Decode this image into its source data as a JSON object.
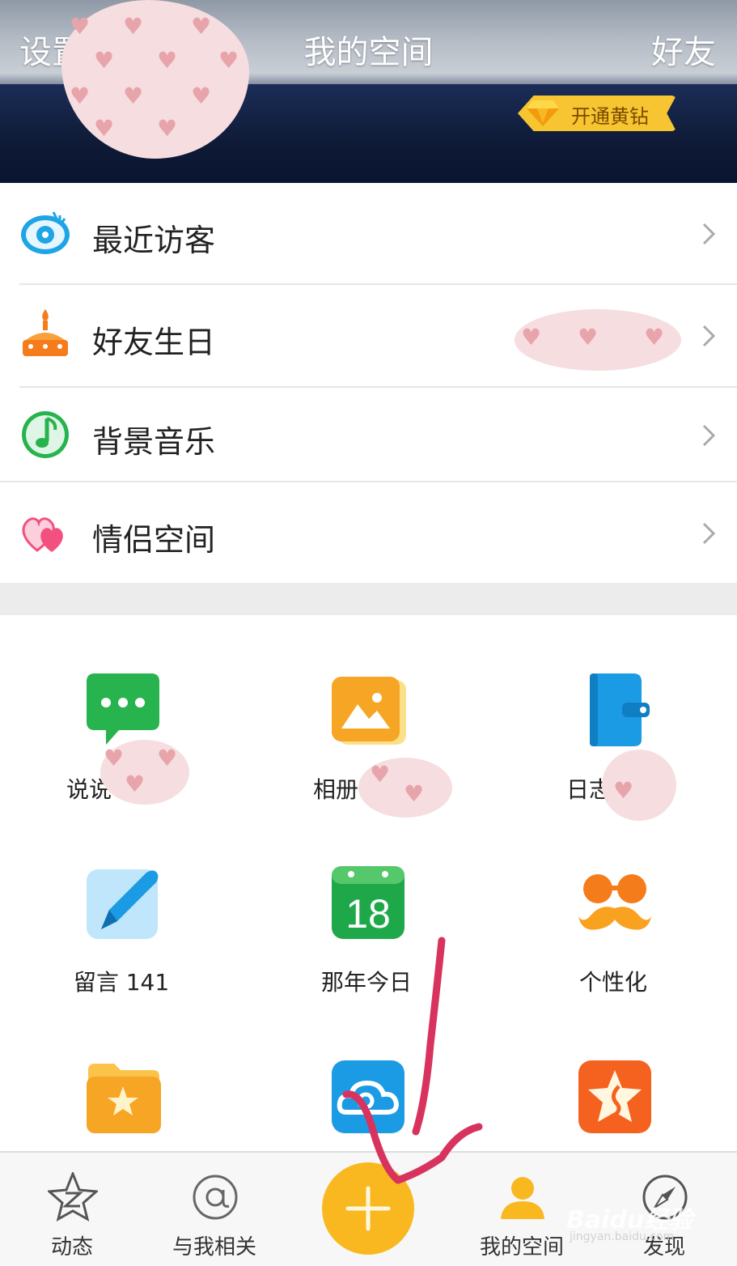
{
  "header": {
    "left_label": "设置",
    "title": "我的空间",
    "right_label": "好友",
    "vip_button": "开通黄钻"
  },
  "menu": {
    "items": [
      {
        "label": "最近访客",
        "icon": "eye-icon"
      },
      {
        "label": "好友生日",
        "icon": "birthday-cake-icon"
      },
      {
        "label": "背景音乐",
        "icon": "music-note-icon"
      },
      {
        "label": "情侣空间",
        "icon": "hearts-icon"
      }
    ]
  },
  "grid": {
    "items": [
      {
        "label": "说说",
        "icon": "chat-bubble-icon"
      },
      {
        "label": "相册",
        "icon": "photo-album-icon"
      },
      {
        "label": "日志",
        "icon": "diary-book-icon"
      },
      {
        "label": "留言 141",
        "icon": "pen-icon"
      },
      {
        "label": "那年今日",
        "icon": "calendar-icon",
        "date": "18"
      },
      {
        "label": "个性化",
        "icon": "mustache-glasses-icon"
      },
      {
        "label": "",
        "icon": "favorites-folder-icon"
      },
      {
        "label": "",
        "icon": "cloud-icon"
      },
      {
        "label": "",
        "icon": "star-badge-icon"
      }
    ]
  },
  "tabbar": {
    "tabs": [
      {
        "label": "动态",
        "icon": "star-z-icon"
      },
      {
        "label": "与我相关",
        "icon": "at-sign-icon"
      },
      {
        "label": "我的空间",
        "icon": "person-icon",
        "active": true
      },
      {
        "label": "发现",
        "icon": "compass-icon"
      }
    ],
    "fab_icon": "plus-icon"
  },
  "watermark": {
    "text": "Baidu经验",
    "sub": "jingyan.baidu.com"
  },
  "colors": {
    "accent": "#f9b81f",
    "green": "#27b34d",
    "blue": "#1b9be4",
    "orange": "#f57c1a",
    "annotation": "#d8335e"
  }
}
